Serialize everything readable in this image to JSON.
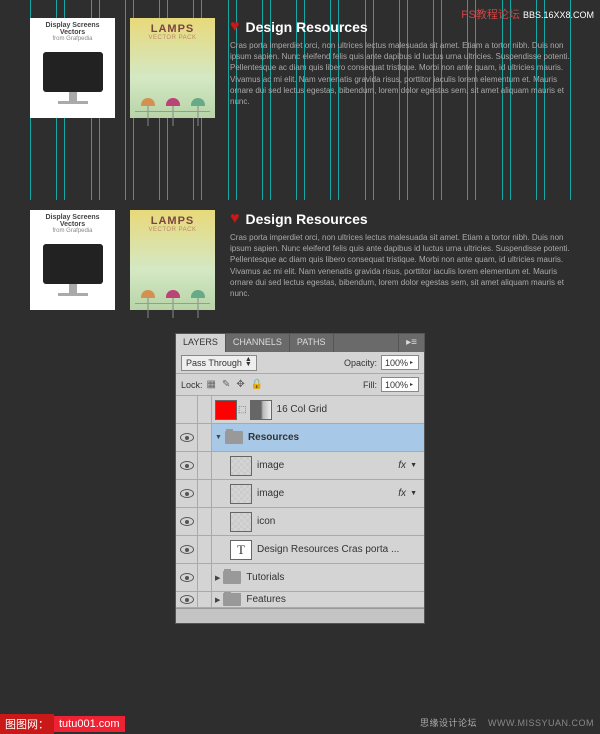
{
  "watermarks": {
    "top_right_a": "PS教程论坛",
    "top_right_b": "BBS.16XX8.COM",
    "bottom_left_a": "图图网：",
    "bottom_left_b": "tutu001.com",
    "bottom_right_a": "思缘设计论坛",
    "bottom_right_b": "WWW.MISSYUAN.COM"
  },
  "thumb1": {
    "title": "Display Screens Vectors",
    "sub": "from Grafpedia"
  },
  "thumb2": {
    "title": "LAMPS",
    "sub": "VECTOR PACK"
  },
  "resources": {
    "title": "Design Resources",
    "body": "Cras porta imperdiet orci, non ultrices lectus malesuada sit amet. Etiam a tortor nibh. Duis non ipsum sapien. Nunc eleifend felis quis ante dapibus id luctus urna ultricies. Suspendisse potenti. Pellentesque ac diam quis libero consequat tristique. Morbi non ante quam, id ultricies mauris. Vivamus ac mi elit. Nam venenatis gravida risus, porttitor iaculis lorem elementum et. Mauris ornare dui sed lectus egestas, bibendum, lorem dolor egestas sem, sit amet aliquam mauris et nunc."
  },
  "panel": {
    "tabs": {
      "layers": "LAYERS",
      "channels": "CHANNELS",
      "paths": "PATHS"
    },
    "blend_mode": "Pass Through",
    "opacity_label": "Opacity:",
    "opacity_value": "100%",
    "lock_label": "Lock:",
    "fill_label": "Fill:",
    "fill_value": "100%",
    "layers": {
      "grid": "16 Col Grid",
      "resources": "Resources",
      "image1": "image",
      "image2": "image",
      "icon": "icon",
      "text": "Design Resources  Cras porta ...",
      "tutorials": "Tutorials",
      "features": "Features"
    },
    "fx_label": "fx"
  }
}
